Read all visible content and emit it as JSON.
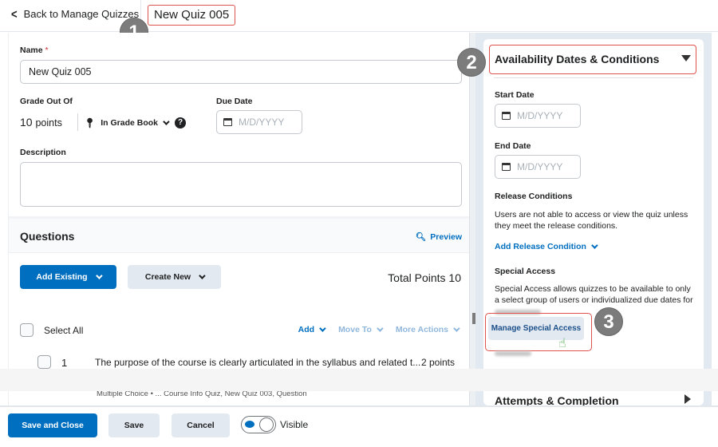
{
  "header": {
    "back_label": "Back to Manage Quizzes",
    "quiz_title": "New Quiz 005"
  },
  "callouts": [
    "1",
    "2",
    "3"
  ],
  "form": {
    "name_label": "Name",
    "name_required_marker": "*",
    "name_value": "New Quiz 005",
    "grade_label": "Grade Out Of",
    "grade_value": "10",
    "grade_unit": "points",
    "gradebook_label": "In Grade Book",
    "help_icon": "?",
    "due_date_label": "Due Date",
    "date_placeholder": "M/D/YYYY",
    "description_label": "Description",
    "description_value": ""
  },
  "questions": {
    "title": "Questions",
    "preview_label": "Preview",
    "add_existing_label": "Add Existing",
    "create_new_label": "Create New",
    "total_points_label": "Total Points 10",
    "select_all_label": "Select All",
    "actions": {
      "add": "Add",
      "move_to": "Move To",
      "more_actions": "More Actions"
    },
    "items": [
      {
        "number": "1",
        "text": "The purpose of the course is clearly articulated in the syllabus and related t...",
        "points": "2 points",
        "meta": "Multiple Choice  •  ... Course Info Quiz, New Quiz 003, Question"
      }
    ]
  },
  "sidebar": {
    "availability_title": "Availability Dates & Conditions",
    "start_date_label": "Start Date",
    "end_date_label": "End Date",
    "date_placeholder": "M/D/YYYY",
    "release_conditions_label": "Release Conditions",
    "release_conditions_text": "Users are not able to access or view the quiz unless they meet the release conditions.",
    "add_release_condition_label": "Add Release Condition",
    "special_access_label": "Special Access",
    "special_access_text": "Special Access allows quizzes to be available to only a select group of users or individualized due dates for",
    "manage_special_access_label": "Manage Special Access",
    "attempts_title": "Attempts & Completion"
  },
  "footer": {
    "save_close_label": "Save and Close",
    "save_label": "Save",
    "cancel_label": "Cancel",
    "visible_label": "Visible",
    "visible_on": true
  },
  "colors": {
    "primary": "#006fbf",
    "secondary_btn": "#e3e9f1",
    "callout_outline": "#e0524c",
    "callout_badge": "#7c7c7c"
  }
}
